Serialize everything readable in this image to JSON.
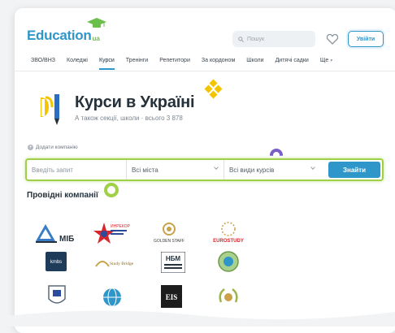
{
  "header": {
    "logo_text": "Education",
    "logo_suffix": "ua",
    "search_placeholder": "Пошук",
    "login_label": "Увійти"
  },
  "nav": {
    "items": [
      "ЗВО/ВНЗ",
      "Коледжі",
      "Курси",
      "Тренінги",
      "Репетитори",
      "За кордоном",
      "Школи",
      "Дитячі садки",
      "Ще"
    ],
    "active": "Курси"
  },
  "page": {
    "title": "Курси в Україні",
    "subtitle": "А також секції, школи · всього 3 878",
    "add_company": "Додати компанію"
  },
  "filter": {
    "query_placeholder": "Введіть запит",
    "city_value": "Всі міста",
    "type_value": "Всі види курсів",
    "find_label": "Знайти"
  },
  "leading": {
    "title": "Провідні компанії",
    "logos": [
      {
        "name": "mib-logo",
        "text": "МІБ"
      },
      {
        "name": "ibrecor-logo",
        "text": "ИНРЕКОР"
      },
      {
        "name": "golden-staff-logo",
        "text": "GOLDEN STAFF"
      },
      {
        "name": "eurostudy-logo",
        "text": "EUROSTUDY"
      },
      {
        "name": "kmbs-logo",
        "text": "kmbs"
      },
      {
        "name": "study-bridge-logo",
        "text": "Study Bridge"
      },
      {
        "name": "nbm-logo",
        "text": "НБМ"
      },
      {
        "name": "round-emblem-logo",
        "text": ""
      },
      {
        "name": "shield-logo",
        "text": ""
      },
      {
        "name": "globe-logo",
        "text": ""
      },
      {
        "name": "eis-logo",
        "text": "EIS"
      },
      {
        "name": "wreath-logo",
        "text": ""
      }
    ]
  },
  "colors": {
    "brand_blue": "#2f96c9",
    "accent_green": "#9fd048",
    "accent_yellow": "#f5c400",
    "accent_purple": "#7b5cc9"
  }
}
